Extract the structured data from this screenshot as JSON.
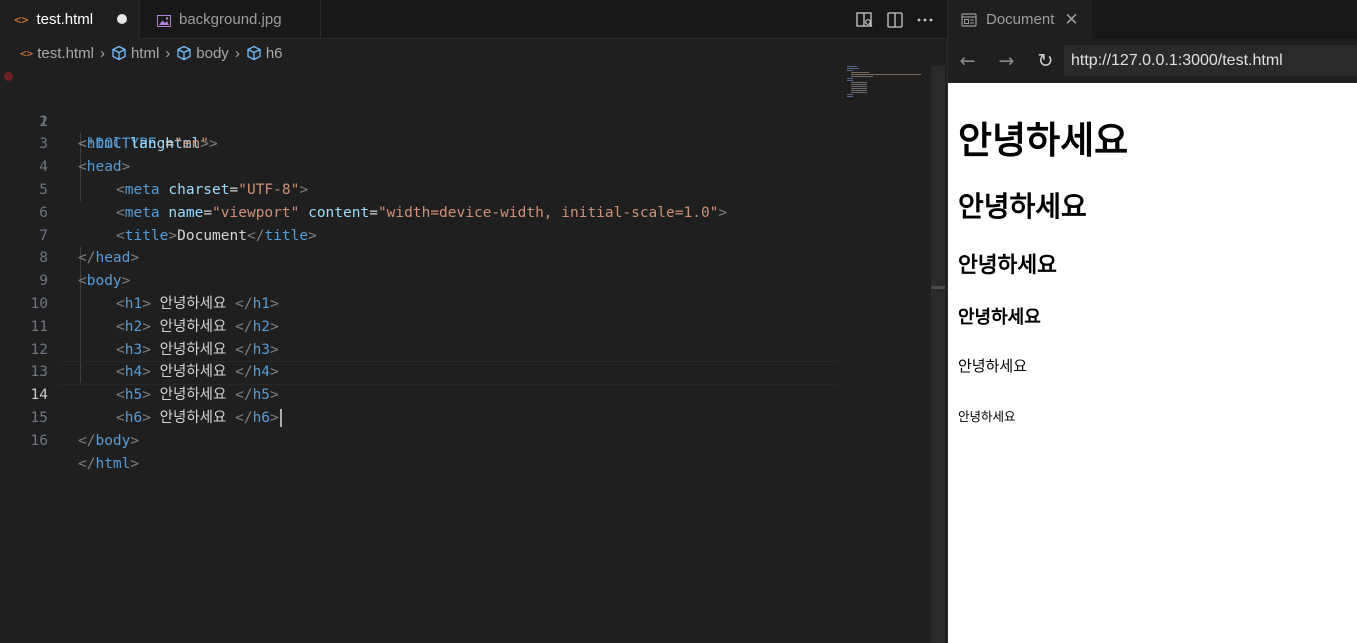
{
  "editor": {
    "tabs": [
      {
        "label": "test.html",
        "active": true,
        "dirty": true,
        "icon": "html-icon"
      },
      {
        "label": "background.jpg",
        "active": false,
        "icon": "image-icon"
      }
    ],
    "breadcrumb": [
      "test.html",
      "html",
      "body",
      "h6"
    ],
    "current_line": 14,
    "line_numbers": [
      "1",
      "2",
      "3",
      "4",
      "5",
      "6",
      "7",
      "8",
      "9",
      "10",
      "11",
      "12",
      "13",
      "14",
      "15",
      "16"
    ],
    "code": {
      "l1": [
        "<!",
        "DOCTYPE",
        " html",
        ">"
      ],
      "l2": [
        "<",
        "html",
        " lang",
        "=",
        "\"en\"",
        ">"
      ],
      "l3": [
        "<",
        "head",
        ">"
      ],
      "l4": [
        "<",
        "meta",
        " charset",
        "=",
        "\"UTF-8\"",
        ">"
      ],
      "l5": [
        "<",
        "meta",
        " name",
        "=",
        "\"viewport\"",
        " content",
        "=",
        "\"width=device-width, initial-scale=1.0\"",
        ">"
      ],
      "l6": [
        "<",
        "title",
        ">",
        "Document",
        "</",
        "title",
        ">"
      ],
      "l7": [
        "</",
        "head",
        ">"
      ],
      "l8": [
        "<",
        "body",
        ">"
      ],
      "l9": [
        "<",
        "h1",
        ">",
        " 안녕하세요 ",
        "</",
        "h1",
        ">"
      ],
      "l10": [
        "<",
        "h2",
        ">",
        " 안녕하세요 ",
        "</",
        "h2",
        ">"
      ],
      "l11": [
        "<",
        "h3",
        ">",
        " 안녕하세요 ",
        "</",
        "h3",
        ">"
      ],
      "l12": [
        "<",
        "h4",
        ">",
        " 안녕하세요 ",
        "</",
        "h4",
        ">"
      ],
      "l13": [
        "<",
        "h5",
        ">",
        " 안녕하세요 ",
        "</",
        "h5",
        ">"
      ],
      "l14": [
        "<",
        "h6",
        ">",
        " 안녕하세요 ",
        "</",
        "h6",
        ">"
      ],
      "l15": [
        "</",
        "body",
        ">"
      ],
      "l16": [
        "</",
        "html",
        ">"
      ]
    }
  },
  "preview": {
    "tab_label": "Document",
    "url": "http://127.0.0.1:3000/test.html",
    "headings": {
      "h1": "안녕하세요",
      "h2": "안녕하세요",
      "h3": "안녕하세요",
      "h4": "안녕하세요",
      "h5": "안녕하세요",
      "h6": "안녕하세요"
    }
  },
  "colors": {
    "editor_bg": "#1f1f1f",
    "tag_name": "#569cd6",
    "attribute": "#9cdcfe",
    "string": "#ce9178",
    "html_icon": "#e37933"
  }
}
